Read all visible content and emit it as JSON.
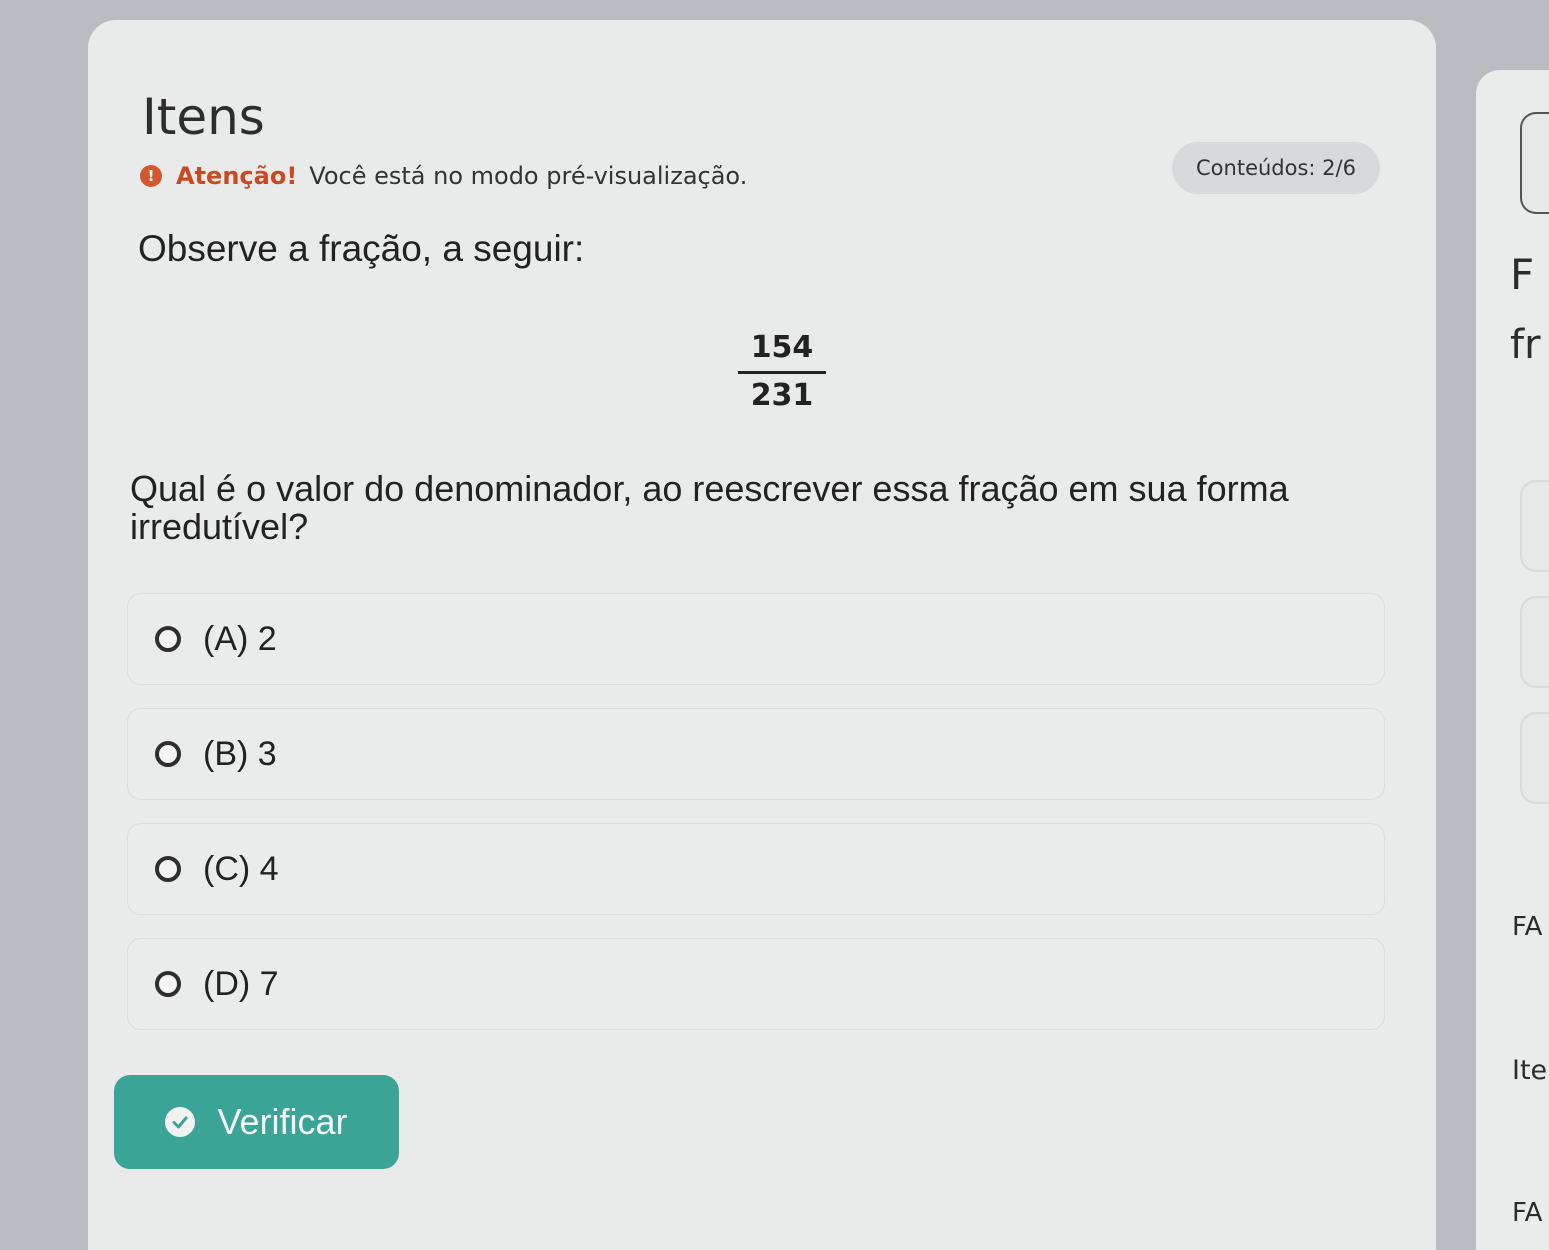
{
  "page": {
    "title": "Itens",
    "alert": {
      "strong": "Atenção!",
      "message": "Você está no modo pré-visualização."
    },
    "progress_badge": "Conteúdos: 2/6"
  },
  "question": {
    "prompt": "Observe a fração, a seguir:",
    "fraction": {
      "numerator": "154",
      "denominator": "231"
    },
    "text": "Qual é o valor do denominador, ao reescrever essa fração em sua forma irredutível?",
    "options": [
      {
        "label": "(A) 2"
      },
      {
        "label": "(B) 3"
      },
      {
        "label": "(C) 4"
      },
      {
        "label": "(D) 7"
      }
    ]
  },
  "actions": {
    "verify_label": "Verificar"
  },
  "side_panel": {
    "heading_fragment": "F",
    "text_fragment": "fr",
    "label_fa_1": "FA",
    "label_ite": "Ite",
    "label_fa_2": "FA"
  },
  "colors": {
    "accent": "#3aa597",
    "alert": "#d4582f"
  }
}
